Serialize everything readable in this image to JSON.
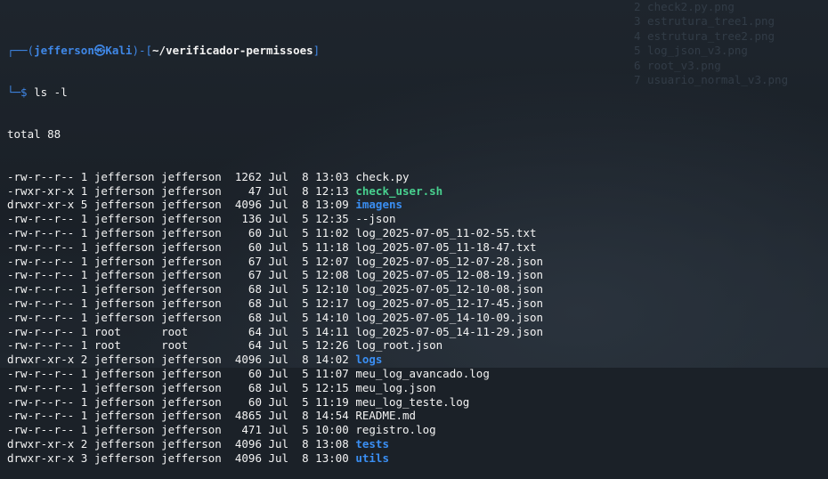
{
  "background_ghost_text": [
    "2 check2.py.png",
    "3 estrutura_tree1.png",
    "4 estrutura_tree2.png",
    "5 log_json_v3.png",
    "6 root_v3.png",
    "7 usuario_normal_v3.png"
  ],
  "prompt": {
    "frame_top": "┌──(",
    "user": "jefferson㉿Kali",
    "mid": ")-[",
    "path": "~/verificador-permissoes",
    "end": "]",
    "frame_bottom": "└─$ ",
    "command": "ls -l"
  },
  "total": "total 88",
  "listing": [
    {
      "perms": "-rw-r--r--",
      "links": "1",
      "owner": "jefferson",
      "group": "jefferson",
      "size": "1262",
      "month": "Jul",
      "day": "8",
      "time": "13:03",
      "name": "check.py",
      "type": "file"
    },
    {
      "perms": "-rwxr-xr-x",
      "links": "1",
      "owner": "jefferson",
      "group": "jefferson",
      "size": "47",
      "month": "Jul",
      "day": "8",
      "time": "12:13",
      "name": "check_user.sh",
      "type": "exe"
    },
    {
      "perms": "drwxr-xr-x",
      "links": "5",
      "owner": "jefferson",
      "group": "jefferson",
      "size": "4096",
      "month": "Jul",
      "day": "8",
      "time": "13:09",
      "name": "imagens",
      "type": "dir"
    },
    {
      "perms": "-rw-r--r--",
      "links": "1",
      "owner": "jefferson",
      "group": "jefferson",
      "size": "136",
      "month": "Jul",
      "day": "5",
      "time": "12:35",
      "name": "--json",
      "type": "file"
    },
    {
      "perms": "-rw-r--r--",
      "links": "1",
      "owner": "jefferson",
      "group": "jefferson",
      "size": "60",
      "month": "Jul",
      "day": "5",
      "time": "11:02",
      "name": "log_2025-07-05_11-02-55.txt",
      "type": "file"
    },
    {
      "perms": "-rw-r--r--",
      "links": "1",
      "owner": "jefferson",
      "group": "jefferson",
      "size": "60",
      "month": "Jul",
      "day": "5",
      "time": "11:18",
      "name": "log_2025-07-05_11-18-47.txt",
      "type": "file"
    },
    {
      "perms": "-rw-r--r--",
      "links": "1",
      "owner": "jefferson",
      "group": "jefferson",
      "size": "67",
      "month": "Jul",
      "day": "5",
      "time": "12:07",
      "name": "log_2025-07-05_12-07-28.json",
      "type": "file"
    },
    {
      "perms": "-rw-r--r--",
      "links": "1",
      "owner": "jefferson",
      "group": "jefferson",
      "size": "67",
      "month": "Jul",
      "day": "5",
      "time": "12:08",
      "name": "log_2025-07-05_12-08-19.json",
      "type": "file"
    },
    {
      "perms": "-rw-r--r--",
      "links": "1",
      "owner": "jefferson",
      "group": "jefferson",
      "size": "68",
      "month": "Jul",
      "day": "5",
      "time": "12:10",
      "name": "log_2025-07-05_12-10-08.json",
      "type": "file"
    },
    {
      "perms": "-rw-r--r--",
      "links": "1",
      "owner": "jefferson",
      "group": "jefferson",
      "size": "68",
      "month": "Jul",
      "day": "5",
      "time": "12:17",
      "name": "log_2025-07-05_12-17-45.json",
      "type": "file"
    },
    {
      "perms": "-rw-r--r--",
      "links": "1",
      "owner": "jefferson",
      "group": "jefferson",
      "size": "68",
      "month": "Jul",
      "day": "5",
      "time": "14:10",
      "name": "log_2025-07-05_14-10-09.json",
      "type": "file"
    },
    {
      "perms": "-rw-r--r--",
      "links": "1",
      "owner": "root",
      "group": "root",
      "size": "64",
      "month": "Jul",
      "day": "5",
      "time": "14:11",
      "name": "log_2025-07-05_14-11-29.json",
      "type": "file"
    },
    {
      "perms": "-rw-r--r--",
      "links": "1",
      "owner": "root",
      "group": "root",
      "size": "64",
      "month": "Jul",
      "day": "5",
      "time": "12:26",
      "name": "log_root.json",
      "type": "file"
    },
    {
      "perms": "drwxr-xr-x",
      "links": "2",
      "owner": "jefferson",
      "group": "jefferson",
      "size": "4096",
      "month": "Jul",
      "day": "8",
      "time": "14:02",
      "name": "logs",
      "type": "dir"
    },
    {
      "perms": "-rw-r--r--",
      "links": "1",
      "owner": "jefferson",
      "group": "jefferson",
      "size": "60",
      "month": "Jul",
      "day": "5",
      "time": "11:07",
      "name": "meu_log_avancado.log",
      "type": "file"
    },
    {
      "perms": "-rw-r--r--",
      "links": "1",
      "owner": "jefferson",
      "group": "jefferson",
      "size": "68",
      "month": "Jul",
      "day": "5",
      "time": "12:15",
      "name": "meu_log.json",
      "type": "file"
    },
    {
      "perms": "-rw-r--r--",
      "links": "1",
      "owner": "jefferson",
      "group": "jefferson",
      "size": "60",
      "month": "Jul",
      "day": "5",
      "time": "11:19",
      "name": "meu_log_teste.log",
      "type": "file"
    },
    {
      "perms": "-rw-r--r--",
      "links": "1",
      "owner": "jefferson",
      "group": "jefferson",
      "size": "4865",
      "month": "Jul",
      "day": "8",
      "time": "14:54",
      "name": "README.md",
      "type": "file"
    },
    {
      "perms": "-rw-r--r--",
      "links": "1",
      "owner": "jefferson",
      "group": "jefferson",
      "size": "471",
      "month": "Jul",
      "day": "5",
      "time": "10:00",
      "name": "registro.log",
      "type": "file"
    },
    {
      "perms": "drwxr-xr-x",
      "links": "2",
      "owner": "jefferson",
      "group": "jefferson",
      "size": "4096",
      "month": "Jul",
      "day": "8",
      "time": "13:08",
      "name": "tests",
      "type": "dir"
    },
    {
      "perms": "drwxr-xr-x",
      "links": "3",
      "owner": "jefferson",
      "group": "jefferson",
      "size": "4096",
      "month": "Jul",
      "day": "8",
      "time": "13:00",
      "name": "utils",
      "type": "dir"
    }
  ],
  "colors": {
    "background": "#1b2128",
    "prompt_blue": "#3f87e6",
    "directory_blue": "#3a8ef2",
    "executable_green": "#48d18f",
    "text": "#f3f3f3"
  }
}
